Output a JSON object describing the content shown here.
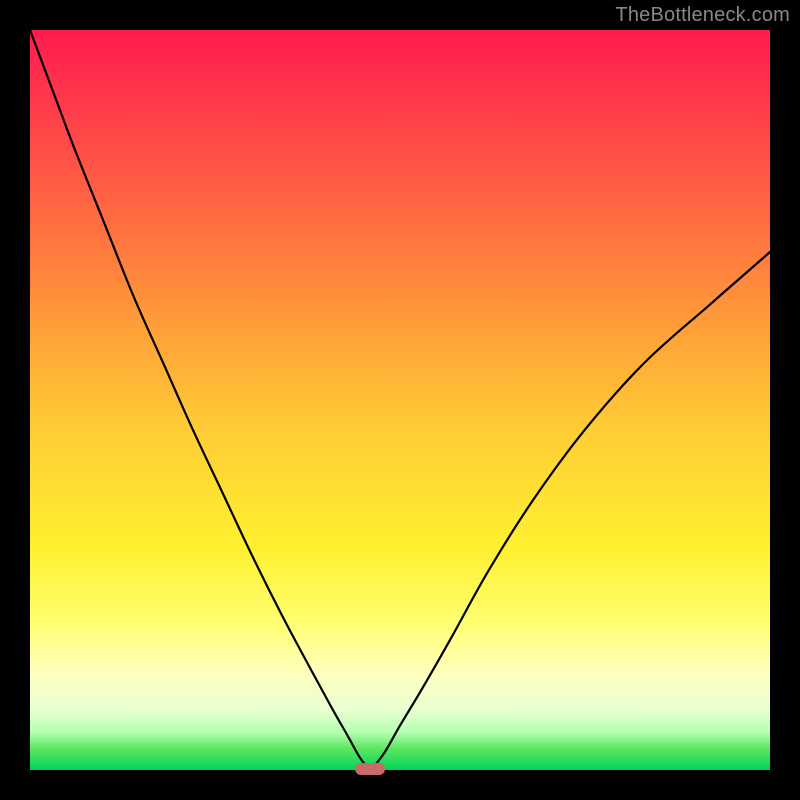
{
  "watermark": "TheBottleneck.com",
  "chart_data": {
    "type": "line",
    "title": "",
    "xlabel": "",
    "ylabel": "",
    "xlim": [
      0,
      100
    ],
    "ylim": [
      0,
      100
    ],
    "grid": false,
    "legend": false,
    "description": "V-shaped bottleneck curve on rainbow gradient (red at top through yellow to green at bottom). Curves represent bottleneck percentage; minimum at marker position.",
    "series": [
      {
        "name": "left-branch",
        "x": [
          0,
          3,
          6,
          10,
          14,
          18,
          22,
          26,
          30,
          34,
          38,
          41,
          43,
          44.5,
          45.5
        ],
        "y": [
          100,
          92,
          84,
          74,
          64,
          55,
          46,
          37.5,
          29,
          21,
          13.5,
          8,
          4.5,
          1.8,
          0.5
        ]
      },
      {
        "name": "right-branch",
        "x": [
          46.5,
          48,
          50,
          53,
          57,
          62,
          68,
          75,
          83,
          92,
          100
        ],
        "y": [
          0.5,
          2.5,
          6,
          11,
          18,
          27,
          36.5,
          46,
          55,
          63,
          70
        ]
      }
    ],
    "marker": {
      "x": 46,
      "y": 0.2,
      "color": "#c96a6a"
    },
    "gradient_stops": [
      {
        "pos": 0,
        "color": "#ff1a4d"
      },
      {
        "pos": 10,
        "color": "#ff3a4a"
      },
      {
        "pos": 20,
        "color": "#ff5a44"
      },
      {
        "pos": 30,
        "color": "#ff7a3e"
      },
      {
        "pos": 42,
        "color": "#ffa538"
      },
      {
        "pos": 55,
        "color": "#ffcf34"
      },
      {
        "pos": 70,
        "color": "#fff030"
      },
      {
        "pos": 80,
        "color": "#ffff70"
      },
      {
        "pos": 87,
        "color": "#ffffc0"
      },
      {
        "pos": 92,
        "color": "#e8ffd0"
      },
      {
        "pos": 95,
        "color": "#b0ffb0"
      },
      {
        "pos": 97,
        "color": "#60e860"
      },
      {
        "pos": 100,
        "color": "#00d45a"
      }
    ]
  }
}
